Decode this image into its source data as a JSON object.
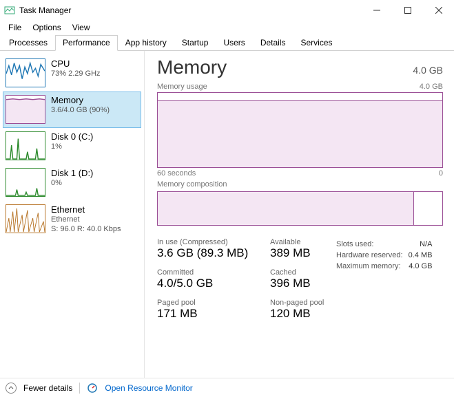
{
  "window": {
    "title": "Task Manager"
  },
  "menu": {
    "file": "File",
    "options": "Options",
    "view": "View"
  },
  "tabs": {
    "processes": "Processes",
    "performance": "Performance",
    "apphistory": "App history",
    "startup": "Startup",
    "users": "Users",
    "details": "Details",
    "services": "Services"
  },
  "sidebar": {
    "cpu": {
      "title": "CPU",
      "sub": "73%  2.29 GHz",
      "color": "#1f77b4"
    },
    "memory": {
      "title": "Memory",
      "sub": "3.6/4.0 GB (90%)",
      "color": "#9b4f96"
    },
    "disk0": {
      "title": "Disk 0 (C:)",
      "sub": "1%",
      "color": "#2e8b2e"
    },
    "disk1": {
      "title": "Disk 1 (D:)",
      "sub": "0%",
      "color": "#2e8b2e"
    },
    "eth": {
      "title": "Ethernet",
      "sub": "Ethernet",
      "sub2": "S: 96.0 R: 40.0 Kbps",
      "color": "#b8762a"
    }
  },
  "main": {
    "heading": "Memory",
    "capacity": "4.0 GB",
    "usage_label": "Memory usage",
    "usage_max": "4.0 GB",
    "axis_left": "60 seconds",
    "axis_right": "0",
    "comp_label": "Memory composition",
    "stats": {
      "inuse_label": "In use (Compressed)",
      "inuse_val": "3.6 GB (89.3 MB)",
      "avail_label": "Available",
      "avail_val": "389 MB",
      "committed_label": "Committed",
      "committed_val": "4.0/5.0 GB",
      "cached_label": "Cached",
      "cached_val": "396 MB",
      "paged_label": "Paged pool",
      "paged_val": "171 MB",
      "nonpaged_label": "Non-paged pool",
      "nonpaged_val": "120 MB"
    },
    "slots": {
      "used_label": "Slots used:",
      "used_val": "N/A",
      "hw_label": "Hardware reserved:",
      "hw_val": "0.4 MB",
      "max_label": "Maximum memory:",
      "max_val": "4.0 GB"
    }
  },
  "footer": {
    "fewer": "Fewer details",
    "rm": "Open Resource Monitor"
  },
  "chart_data": {
    "type": "line",
    "title": "Memory usage",
    "ylim": [
      0,
      4.0
    ],
    "ylabel": "GB",
    "x_range_seconds": 60,
    "series": [
      {
        "name": "In use",
        "approx_value_gb": 3.6,
        "percent": 90
      }
    ],
    "composition": {
      "in_use_gb": 3.6,
      "total_gb": 4.0,
      "percent": 90
    }
  }
}
